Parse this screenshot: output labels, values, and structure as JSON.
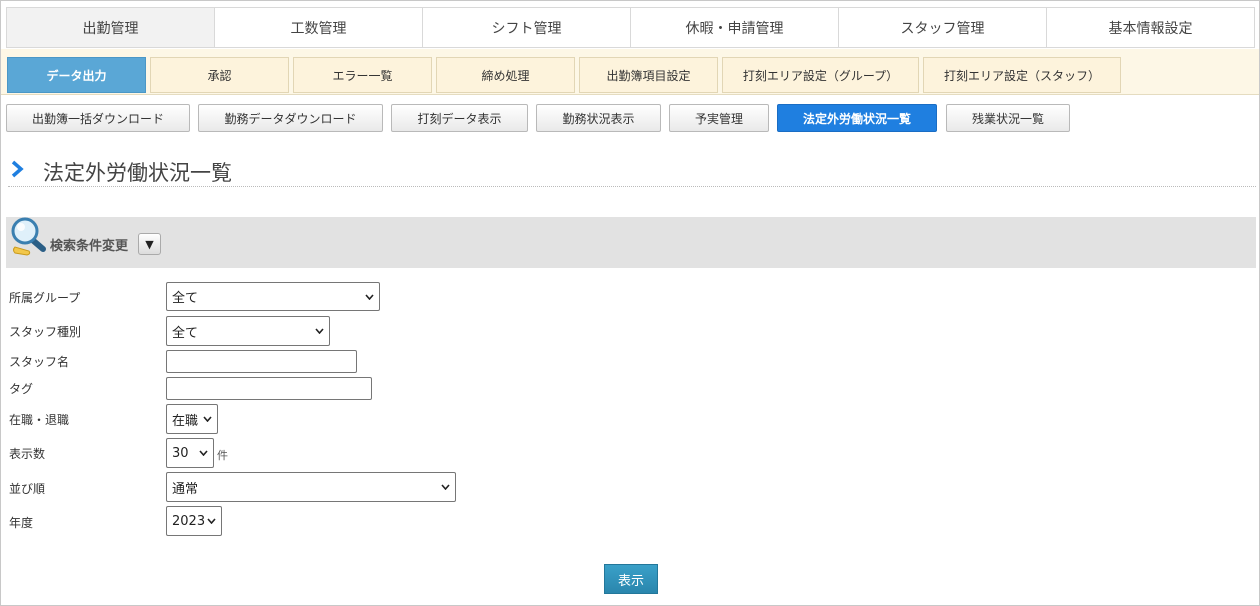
{
  "top_tabs": [
    "出勤管理",
    "工数管理",
    "シフト管理",
    "休暇・申請管理",
    "スタッフ管理",
    "基本情報設定"
  ],
  "sub_tabs": [
    "データ出力",
    "承認",
    "エラー一覧",
    "締め処理",
    "出勤簿項目設定",
    "打刻エリア設定（グループ）",
    "打刻エリア設定（スタッフ）"
  ],
  "buttons": [
    "出勤簿一括ダウンロード",
    "勤務データダウンロード",
    "打刻データ表示",
    "勤務状況表示",
    "予実管理",
    "法定外労働状況一覧",
    "残業状況一覧"
  ],
  "page_title": "法定外労働状況一覧",
  "search": {
    "label": "検索条件変更",
    "toggle_icon": "▼"
  },
  "form": {
    "group_label": "所属グループ",
    "group_value": "全て",
    "staff_type_label": "スタッフ種別",
    "staff_type_value": "全て",
    "staff_name_label": "スタッフ名",
    "staff_name_value": "",
    "tag_label": "タグ",
    "tag_value": "",
    "employment_label": "在職・退職",
    "employment_value": "在職",
    "count_label": "表示数",
    "count_value": "30",
    "count_unit": "件",
    "order_label": "並び順",
    "order_value": "通常",
    "year_label": "年度",
    "year_value": "2023"
  },
  "submit_label": "表示",
  "colors": {
    "active_sub_tab": "#5aa7d6",
    "active_button": "#1f7fe0",
    "submit": "#2a86ad",
    "chevron": "#1f7fe0"
  }
}
